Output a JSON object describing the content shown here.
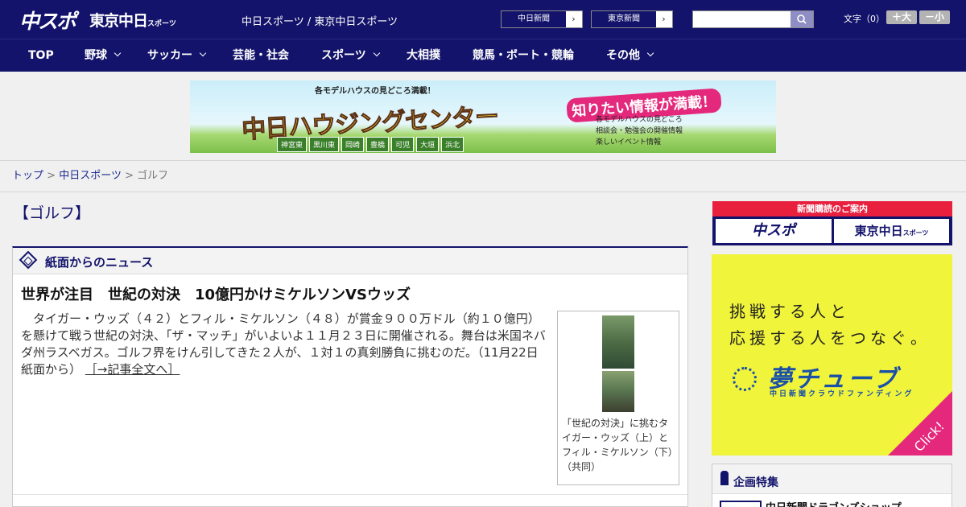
{
  "header": {
    "logo_chuspo": "中スポ",
    "logo_tokyo": "東京中日",
    "logo_tokyo_suffix": "スポーツ",
    "site_name": "中日スポーツ / 東京中日スポーツ",
    "paper_buttons": [
      {
        "label": "中日新聞",
        "arrow": "›"
      },
      {
        "label": "東京新聞",
        "arrow": "›"
      }
    ],
    "search": {
      "placeholder": "",
      "icon": "search-icon"
    },
    "font_size_label": "文字（0）",
    "font_larger": "＋大",
    "font_smaller": "－小"
  },
  "nav": {
    "items": [
      {
        "label": "TOP",
        "dropdown": false
      },
      {
        "label": "野球",
        "dropdown": true
      },
      {
        "label": "サッカー",
        "dropdown": true
      },
      {
        "label": "芸能・社会",
        "dropdown": false
      },
      {
        "label": "スポーツ",
        "dropdown": true
      },
      {
        "label": "大相撲",
        "dropdown": false
      },
      {
        "label": "競馬・ボート・競輪",
        "dropdown": false
      },
      {
        "label": "その他",
        "dropdown": true
      }
    ]
  },
  "ad_banner": {
    "top_text": "各モデルハウスの見どころ満載！",
    "main_text": "中日ハウジングセンター",
    "cities": [
      "神宮東",
      "黒川東",
      "岡崎",
      "豊橋",
      "可児",
      "大垣",
      "浜北"
    ],
    "pink_text": "知りたい情報が満載！",
    "info_lines": [
      "各モデルハウスの見どころ",
      "相談会・勉強会の開催情報",
      "楽しいイベント情報"
    ]
  },
  "breadcrumb": {
    "items": [
      "トップ",
      "中日スポーツ"
    ],
    "separator": ">",
    "current": "ゴルフ"
  },
  "page": {
    "title": "【ゴルフ】"
  },
  "news_section": {
    "title": "紙面からのニュース",
    "headline": "世界が注目　世紀の対決　10億円かけミケルソンVSウッズ",
    "body": "　タイガー・ウッズ（４２）とフィル・ミケルソン（４８）が賞金９００万ドル（約１０億円）を懸けて戦う世紀の対決、「ザ・マッチ」がいよいよ１１月２３日に開催される。舞台は米国ネバダ州ラスベガス。ゴルフ界をけん引してきた２人が、１対１の真剣勝負に挑むのだ。（11月22日 紙面から）",
    "more_link": "［→記事全文へ］",
    "photo_caption": "「世紀の対決」に挑むタイガー・ウッズ（上）とフィル・ミケルソン（下）（共同）"
  },
  "sidebar": {
    "subscribe_title": "新聞購読のご案内",
    "subscribe_chuspo": "中スポ",
    "subscribe_tokyo": "東京中日",
    "subscribe_tokyo_suffix": "スポーツ",
    "yume_line1": "挑戦する人と",
    "yume_line2": "応援する人をつなぐ。",
    "yume_brand": "夢チューブ",
    "yume_sub": "中日新聞クラウドファンディング",
    "yume_click": "Click!",
    "feature_title": "企画特集",
    "feature_item": "中日新聞ドラゴンズショップ"
  },
  "colors": {
    "header_bg": "#13136b",
    "accent_red": "#e8203e",
    "accent_pink": "#e4287c",
    "yume_yellow": "#f0f43a"
  }
}
